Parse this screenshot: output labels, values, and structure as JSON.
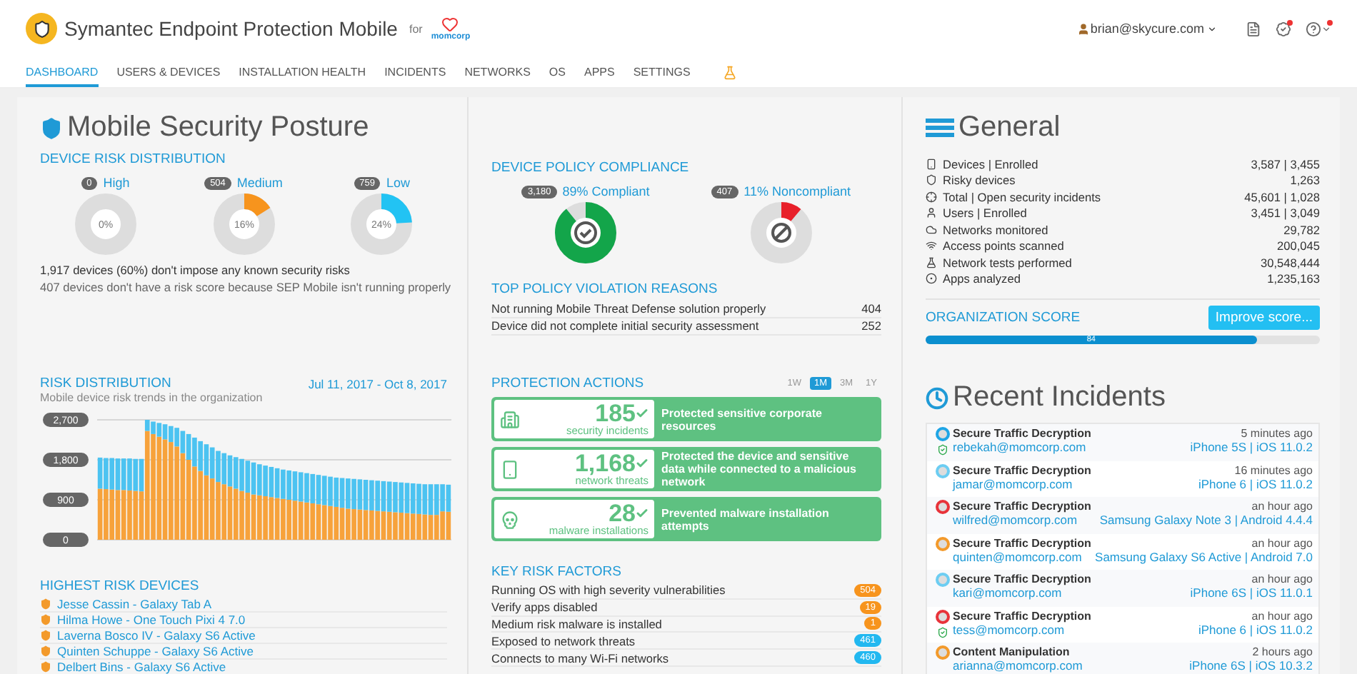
{
  "header": {
    "title": "Symantec Endpoint Protection Mobile",
    "for_label": "for",
    "brand": "momcorp",
    "user": "brian@skycure.com"
  },
  "nav": [
    {
      "label": "DASHBOARD",
      "selected": true
    },
    {
      "label": "USERS & DEVICES",
      "selected": false
    },
    {
      "label": "INSTALLATION HEALTH",
      "selected": false
    },
    {
      "label": "INCIDENTS",
      "selected": false
    },
    {
      "label": "NETWORKS",
      "selected": false
    },
    {
      "label": "OS",
      "selected": false
    },
    {
      "label": "APPS",
      "selected": false
    },
    {
      "label": "SETTINGS",
      "selected": false
    }
  ],
  "posture": {
    "title": "Mobile Security Posture",
    "heading": "DEVICE RISK DISTRIBUTION",
    "levels": [
      {
        "count": "0",
        "label": "High",
        "percent": "0%",
        "level": 0
      },
      {
        "count": "504",
        "label": "Medium",
        "percent": "16%",
        "level": 0.16,
        "color": "#f7941d"
      },
      {
        "count": "759",
        "label": "Low",
        "percent": "24%",
        "level": 0.24,
        "color": "#22c3f3"
      }
    ],
    "notes": [
      "1,917 devices (60%) don't impose any known security risks",
      "407 devices don't have a risk score because SEP Mobile isn't running properly"
    ]
  },
  "risk_trend": {
    "title": "RISK DISTRIBUTION",
    "range": "Jul 11, 2017 - Oct 8, 2017",
    "subtitle": "Mobile device risk trends in the organization",
    "chart_data": {
      "type": "bar",
      "stacked": true,
      "ylim": [
        0,
        2700
      ],
      "yticks": [
        {
          "value": 0,
          "label": "0"
        },
        {
          "value": 900,
          "label": "900"
        },
        {
          "value": 1800,
          "label": "1,800"
        },
        {
          "value": 2700,
          "label": "2,700"
        }
      ],
      "series": [
        {
          "color": "#f7a23b",
          "values": [
            1150,
            1140,
            1130,
            1120,
            1120,
            1110,
            1100,
            1090,
            2450,
            2380,
            2320,
            2260,
            2200,
            2100,
            1950,
            1800,
            1650,
            1550,
            1450,
            1380,
            1300,
            1250,
            1200,
            1150,
            1100,
            1060,
            1020,
            1000,
            980,
            960,
            940,
            920,
            900,
            880,
            860,
            840,
            820,
            800,
            780,
            760,
            740,
            720,
            700,
            690,
            680,
            670,
            660,
            650,
            640,
            630,
            620,
            610,
            600,
            590,
            580,
            570,
            560,
            560,
            640,
            630
          ]
        },
        {
          "color": "#4cc3f1",
          "values": [
            700,
            700,
            710,
            710,
            710,
            720,
            720,
            730,
            250,
            280,
            310,
            340,
            360,
            420,
            500,
            580,
            650,
            670,
            700,
            700,
            700,
            700,
            700,
            710,
            720,
            720,
            720,
            700,
            690,
            680,
            670,
            660,
            660,
            660,
            660,
            660,
            660,
            660,
            660,
            660,
            660,
            670,
            680,
            680,
            680,
            680,
            680,
            680,
            680,
            680,
            680,
            680,
            680,
            680,
            680,
            680,
            690,
            690,
            610,
            610
          ]
        }
      ]
    }
  },
  "highest_risk_devices": {
    "title": "HIGHEST RISK DEVICES",
    "items": [
      "Jesse Cassin - Galaxy Tab A",
      "Hilma Howe - One Touch Pixi 4 7.0",
      "Laverna Bosco IV - Galaxy S6 Active",
      "Quinten Schuppe - Galaxy S6 Active",
      "Delbert Bins - Galaxy S6 Active"
    ]
  },
  "compliance": {
    "title": "DEVICE POLICY COMPLIANCE",
    "items": [
      {
        "kind": "compliant",
        "count": "3,180",
        "label": "89% Compliant",
        "level": 0.89,
        "color": "#13a54a"
      },
      {
        "kind": "noncompliant",
        "count": "407",
        "label": "11% Noncompliant",
        "level": 0.11,
        "color": "#e8202a"
      }
    ]
  },
  "violations": {
    "title": "TOP POLICY VIOLATION REASONS",
    "rows": [
      {
        "reason": "Not running Mobile Threat Defense solution properly",
        "count": "404"
      },
      {
        "reason": "Device did not complete initial security assessment",
        "count": "252"
      }
    ]
  },
  "protection": {
    "title": "PROTECTION ACTIONS",
    "periods": [
      {
        "label": "1W",
        "selected": false
      },
      {
        "label": "1M",
        "selected": true
      },
      {
        "label": "3M",
        "selected": false
      },
      {
        "label": "1Y",
        "selected": false
      }
    ],
    "cards": [
      {
        "kind": "building",
        "count": "185",
        "unit": "security incidents",
        "description": "Protected sensitive corporate resources"
      },
      {
        "kind": "phone",
        "count": "1,168",
        "unit": "network threats",
        "description": "Protected the device and sensitive data while connected to a malicious network"
      },
      {
        "kind": "malware",
        "count": "28",
        "unit": "malware installations",
        "description": "Prevented malware installation attempts"
      }
    ]
  },
  "key_risk_factors": {
    "title": "KEY RISK FACTORS",
    "rows": [
      {
        "label": "Running OS with high severity vulnerabilities",
        "count": "504",
        "color": "#f7941d"
      },
      {
        "label": "Verify apps disabled",
        "count": "19",
        "color": "#f7941d"
      },
      {
        "label": "Medium risk malware is installed",
        "count": "1",
        "color": "#f7941d"
      },
      {
        "label": "Exposed to network threats",
        "count": "461",
        "color": "#22b8f0"
      },
      {
        "label": "Connects to many Wi-Fi networks",
        "count": "460",
        "color": "#22b8f0"
      }
    ]
  },
  "general": {
    "title": "General",
    "rows": [
      {
        "kind": "device",
        "label": "Devices | Enrolled",
        "value": "3,587 | 3,455"
      },
      {
        "kind": "shield",
        "label": "Risky devices",
        "value": "1,263"
      },
      {
        "kind": "target",
        "label": "Total | Open security incidents",
        "value": "45,601 | 1,028"
      },
      {
        "kind": "user",
        "label": "Users | Enrolled",
        "value": "3,451 | 3,049"
      },
      {
        "kind": "cloud",
        "label": "Networks monitored",
        "value": "29,782"
      },
      {
        "kind": "wifi",
        "label": "Access points scanned",
        "value": "200,045"
      },
      {
        "kind": "flask",
        "label": "Network tests performed",
        "value": "30,548,444"
      },
      {
        "kind": "app",
        "label": "Apps analyzed",
        "value": "1,235,163"
      }
    ]
  },
  "org_score": {
    "title": "ORGANIZATION SCORE",
    "button": "Improve score...",
    "score": "84",
    "level": 0.84
  },
  "incidents": {
    "title": "Recent Incidents",
    "rows": [
      {
        "color": "#1ea5e6",
        "protected": true,
        "title": "Secure Traffic Decryption",
        "user": "rebekah@momcorp.com",
        "time": "5 minutes ago",
        "device": "iPhone 5S | iOS 11.0.2"
      },
      {
        "color": "#6ccdf2",
        "protected": false,
        "title": "Secure Traffic Decryption",
        "user": "jamar@momcorp.com",
        "time": "16 minutes ago",
        "device": "iPhone 6 | iOS 11.0.2"
      },
      {
        "color": "#e8333a",
        "protected": false,
        "title": "Secure Traffic Decryption",
        "user": "wilfred@momcorp.com",
        "time": "an hour ago",
        "device": "Samsung Galaxy Note 3 | Android 4.4.4"
      },
      {
        "color": "#f39a2b",
        "protected": false,
        "title": "Secure Traffic Decryption",
        "user": "quinten@momcorp.com",
        "time": "an hour ago",
        "device": "Samsung Galaxy S6 Active | Android 7.0"
      },
      {
        "color": "#6ccdf2",
        "protected": false,
        "title": "Secure Traffic Decryption",
        "user": "kari@momcorp.com",
        "time": "an hour ago",
        "device": "iPhone 6S | iOS 11.0.1"
      },
      {
        "color": "#e8333a",
        "protected": true,
        "title": "Secure Traffic Decryption",
        "user": "tess@momcorp.com",
        "time": "an hour ago",
        "device": "iPhone 6 | iOS 11.0.2"
      },
      {
        "color": "#f39a2b",
        "protected": false,
        "title": "Content Manipulation",
        "user": "arianna@momcorp.com",
        "time": "2 hours ago",
        "device": "iPhone 6S | iOS 10.3.2"
      }
    ]
  }
}
